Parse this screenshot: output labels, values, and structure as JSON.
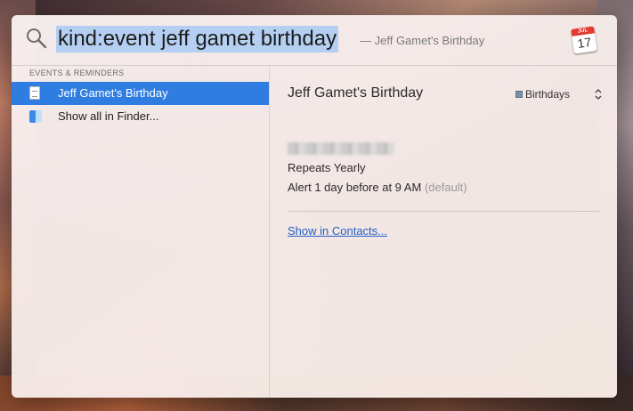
{
  "spotlight": {
    "query": "kind:event jeff gamet birthday",
    "suggestion": "— Jeff Gamet's Birthday",
    "app_icon": "calendar-icon",
    "calendar_icon": {
      "month": "JUL",
      "day": "17"
    }
  },
  "results": {
    "section_title": "EVENTS & REMINDERS",
    "items": [
      {
        "label": "Jeff Gamet's Birthday",
        "icon": "event-document-icon",
        "selected": true
      },
      {
        "label": "Show all in Finder...",
        "icon": "finder-icon",
        "selected": false
      }
    ]
  },
  "preview": {
    "title": "Jeff Gamet's Birthday",
    "calendar_name": "Birthdays",
    "calendar_color": "#7b8fa6",
    "repeats": "Repeats Yearly",
    "alert": "Alert 1 day before at 9 AM",
    "alert_note": "(default)",
    "link": "Show in Contacts..."
  },
  "colors": {
    "selection": "#2f7de1",
    "query_highlight": "#b5cff2",
    "link": "#2360c6"
  }
}
